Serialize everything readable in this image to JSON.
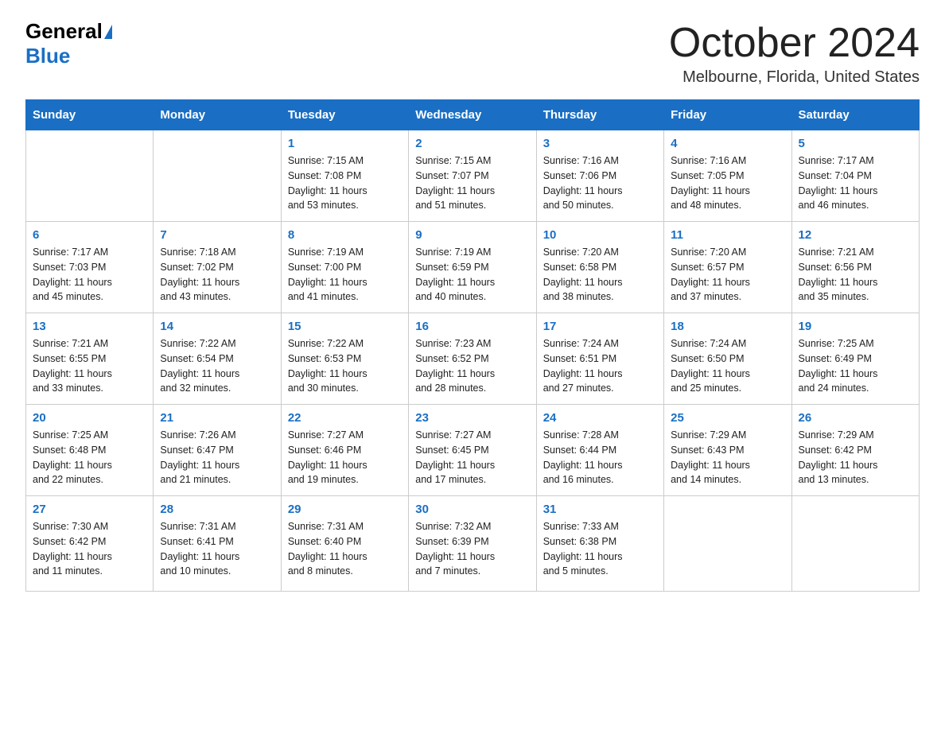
{
  "header": {
    "logo_general": "General",
    "logo_blue": "Blue",
    "month_title": "October 2024",
    "location": "Melbourne, Florida, United States"
  },
  "weekdays": [
    "Sunday",
    "Monday",
    "Tuesday",
    "Wednesday",
    "Thursday",
    "Friday",
    "Saturday"
  ],
  "weeks": [
    [
      {
        "day": "",
        "info": ""
      },
      {
        "day": "",
        "info": ""
      },
      {
        "day": "1",
        "info": "Sunrise: 7:15 AM\nSunset: 7:08 PM\nDaylight: 11 hours\nand 53 minutes."
      },
      {
        "day": "2",
        "info": "Sunrise: 7:15 AM\nSunset: 7:07 PM\nDaylight: 11 hours\nand 51 minutes."
      },
      {
        "day": "3",
        "info": "Sunrise: 7:16 AM\nSunset: 7:06 PM\nDaylight: 11 hours\nand 50 minutes."
      },
      {
        "day": "4",
        "info": "Sunrise: 7:16 AM\nSunset: 7:05 PM\nDaylight: 11 hours\nand 48 minutes."
      },
      {
        "day": "5",
        "info": "Sunrise: 7:17 AM\nSunset: 7:04 PM\nDaylight: 11 hours\nand 46 minutes."
      }
    ],
    [
      {
        "day": "6",
        "info": "Sunrise: 7:17 AM\nSunset: 7:03 PM\nDaylight: 11 hours\nand 45 minutes."
      },
      {
        "day": "7",
        "info": "Sunrise: 7:18 AM\nSunset: 7:02 PM\nDaylight: 11 hours\nand 43 minutes."
      },
      {
        "day": "8",
        "info": "Sunrise: 7:19 AM\nSunset: 7:00 PM\nDaylight: 11 hours\nand 41 minutes."
      },
      {
        "day": "9",
        "info": "Sunrise: 7:19 AM\nSunset: 6:59 PM\nDaylight: 11 hours\nand 40 minutes."
      },
      {
        "day": "10",
        "info": "Sunrise: 7:20 AM\nSunset: 6:58 PM\nDaylight: 11 hours\nand 38 minutes."
      },
      {
        "day": "11",
        "info": "Sunrise: 7:20 AM\nSunset: 6:57 PM\nDaylight: 11 hours\nand 37 minutes."
      },
      {
        "day": "12",
        "info": "Sunrise: 7:21 AM\nSunset: 6:56 PM\nDaylight: 11 hours\nand 35 minutes."
      }
    ],
    [
      {
        "day": "13",
        "info": "Sunrise: 7:21 AM\nSunset: 6:55 PM\nDaylight: 11 hours\nand 33 minutes."
      },
      {
        "day": "14",
        "info": "Sunrise: 7:22 AM\nSunset: 6:54 PM\nDaylight: 11 hours\nand 32 minutes."
      },
      {
        "day": "15",
        "info": "Sunrise: 7:22 AM\nSunset: 6:53 PM\nDaylight: 11 hours\nand 30 minutes."
      },
      {
        "day": "16",
        "info": "Sunrise: 7:23 AM\nSunset: 6:52 PM\nDaylight: 11 hours\nand 28 minutes."
      },
      {
        "day": "17",
        "info": "Sunrise: 7:24 AM\nSunset: 6:51 PM\nDaylight: 11 hours\nand 27 minutes."
      },
      {
        "day": "18",
        "info": "Sunrise: 7:24 AM\nSunset: 6:50 PM\nDaylight: 11 hours\nand 25 minutes."
      },
      {
        "day": "19",
        "info": "Sunrise: 7:25 AM\nSunset: 6:49 PM\nDaylight: 11 hours\nand 24 minutes."
      }
    ],
    [
      {
        "day": "20",
        "info": "Sunrise: 7:25 AM\nSunset: 6:48 PM\nDaylight: 11 hours\nand 22 minutes."
      },
      {
        "day": "21",
        "info": "Sunrise: 7:26 AM\nSunset: 6:47 PM\nDaylight: 11 hours\nand 21 minutes."
      },
      {
        "day": "22",
        "info": "Sunrise: 7:27 AM\nSunset: 6:46 PM\nDaylight: 11 hours\nand 19 minutes."
      },
      {
        "day": "23",
        "info": "Sunrise: 7:27 AM\nSunset: 6:45 PM\nDaylight: 11 hours\nand 17 minutes."
      },
      {
        "day": "24",
        "info": "Sunrise: 7:28 AM\nSunset: 6:44 PM\nDaylight: 11 hours\nand 16 minutes."
      },
      {
        "day": "25",
        "info": "Sunrise: 7:29 AM\nSunset: 6:43 PM\nDaylight: 11 hours\nand 14 minutes."
      },
      {
        "day": "26",
        "info": "Sunrise: 7:29 AM\nSunset: 6:42 PM\nDaylight: 11 hours\nand 13 minutes."
      }
    ],
    [
      {
        "day": "27",
        "info": "Sunrise: 7:30 AM\nSunset: 6:42 PM\nDaylight: 11 hours\nand 11 minutes."
      },
      {
        "day": "28",
        "info": "Sunrise: 7:31 AM\nSunset: 6:41 PM\nDaylight: 11 hours\nand 10 minutes."
      },
      {
        "day": "29",
        "info": "Sunrise: 7:31 AM\nSunset: 6:40 PM\nDaylight: 11 hours\nand 8 minutes."
      },
      {
        "day": "30",
        "info": "Sunrise: 7:32 AM\nSunset: 6:39 PM\nDaylight: 11 hours\nand 7 minutes."
      },
      {
        "day": "31",
        "info": "Sunrise: 7:33 AM\nSunset: 6:38 PM\nDaylight: 11 hours\nand 5 minutes."
      },
      {
        "day": "",
        "info": ""
      },
      {
        "day": "",
        "info": ""
      }
    ]
  ]
}
